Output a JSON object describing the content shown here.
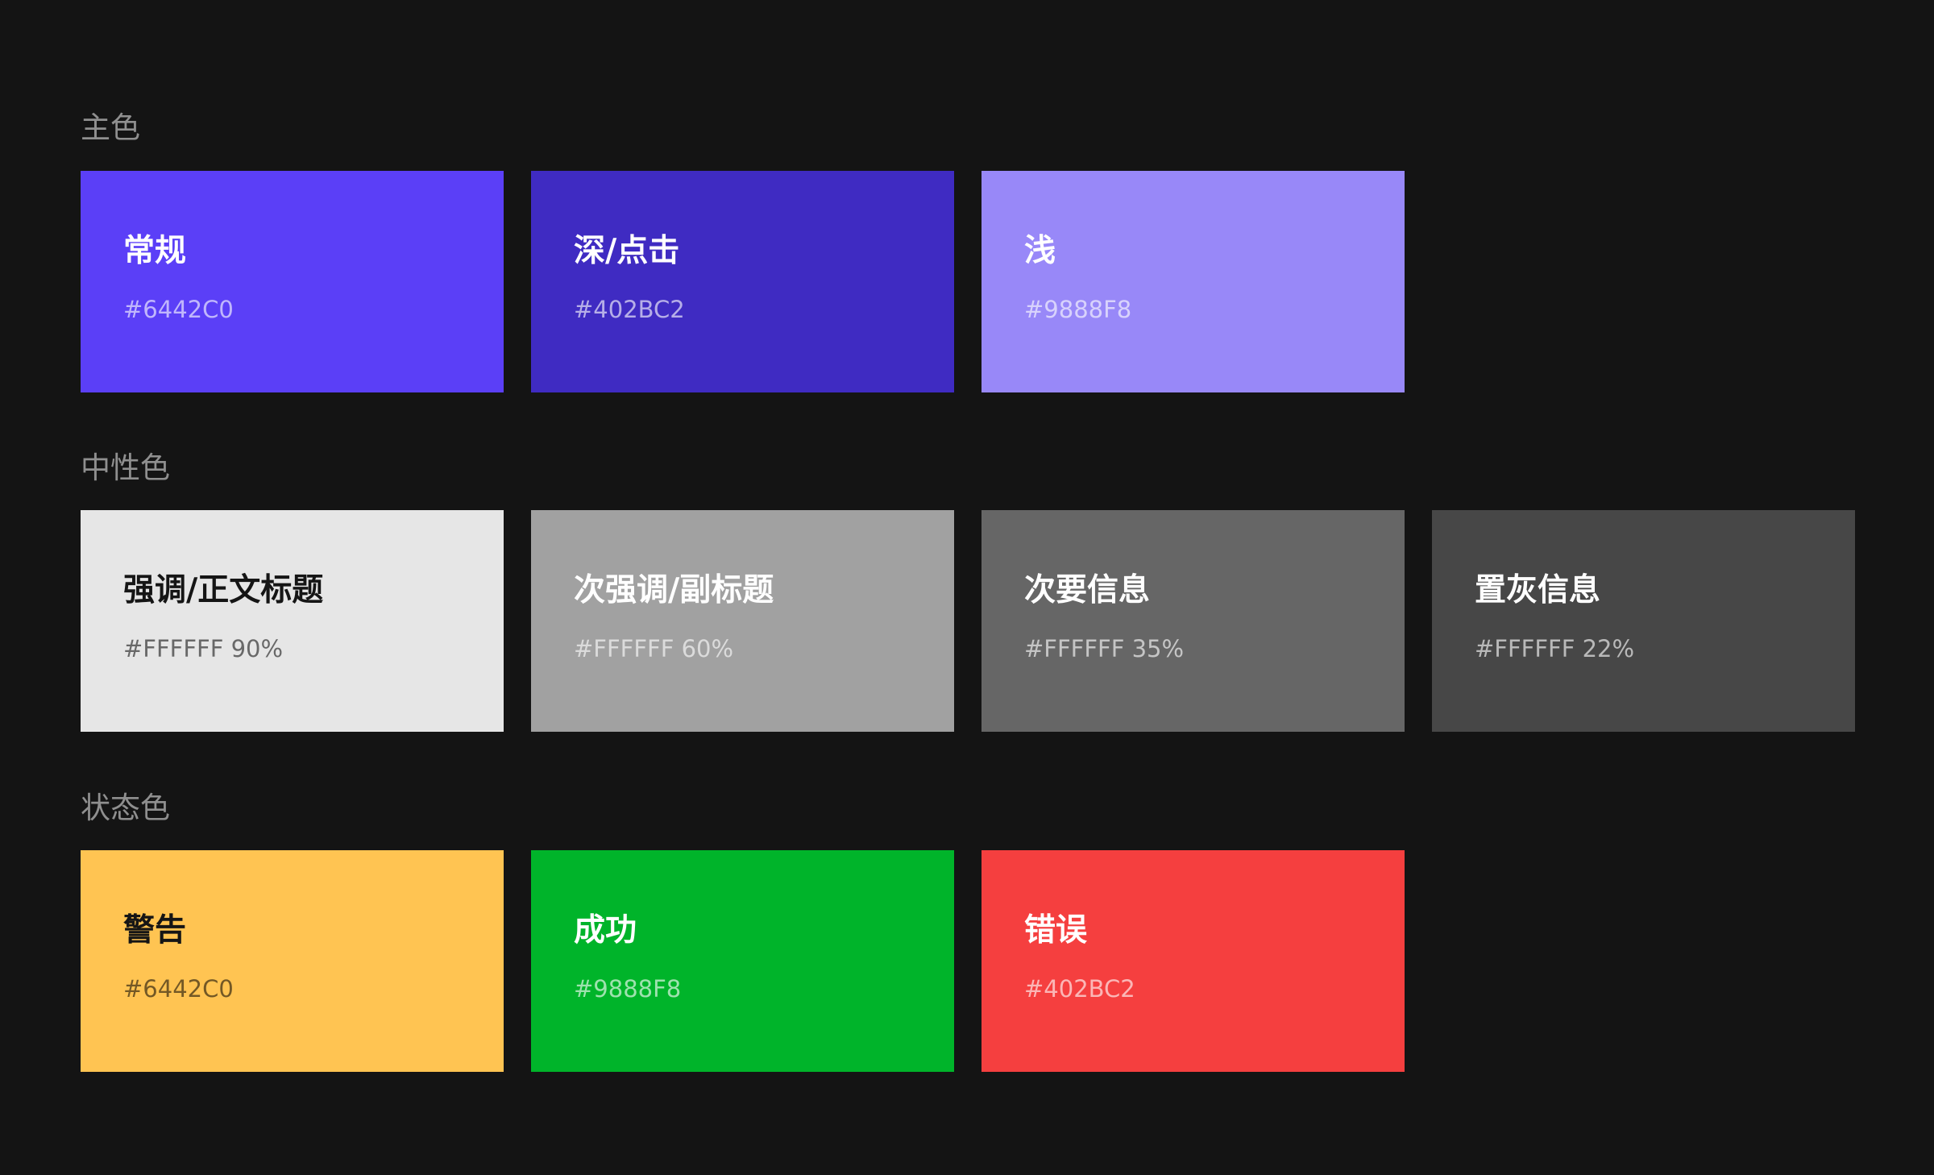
{
  "sections": [
    {
      "title": "主色",
      "swatches": [
        {
          "name": "常规",
          "code": "#6442C0",
          "color": "#5B3FF7"
        },
        {
          "name": "深/点击",
          "code": "#402BC2",
          "color": "#3F2BC2"
        },
        {
          "name": "浅",
          "code": "#9888F8",
          "color": "#9888F8"
        }
      ]
    },
    {
      "title": "中性色",
      "swatches": [
        {
          "name": "强调/正文标题",
          "code": "#FFFFFF 90%",
          "color": "#E6E6E6"
        },
        {
          "name": "次强调/副标题",
          "code": "#FFFFFF 60%",
          "color": "#A1A1A1"
        },
        {
          "name": "次要信息",
          "code": "#FFFFFF 35%",
          "color": "#666666"
        },
        {
          "name": "置灰信息",
          "code": "#FFFFFF 22%",
          "color": "#474747"
        }
      ]
    },
    {
      "title": "状态色",
      "swatches": [
        {
          "name": "警告",
          "code": "#6442C0",
          "color": "#FFC452"
        },
        {
          "name": "成功",
          "code": "#9888F8",
          "color": "#00B42A"
        },
        {
          "name": "错误",
          "code": "#402BC2",
          "color": "#F53F3F"
        }
      ]
    }
  ]
}
